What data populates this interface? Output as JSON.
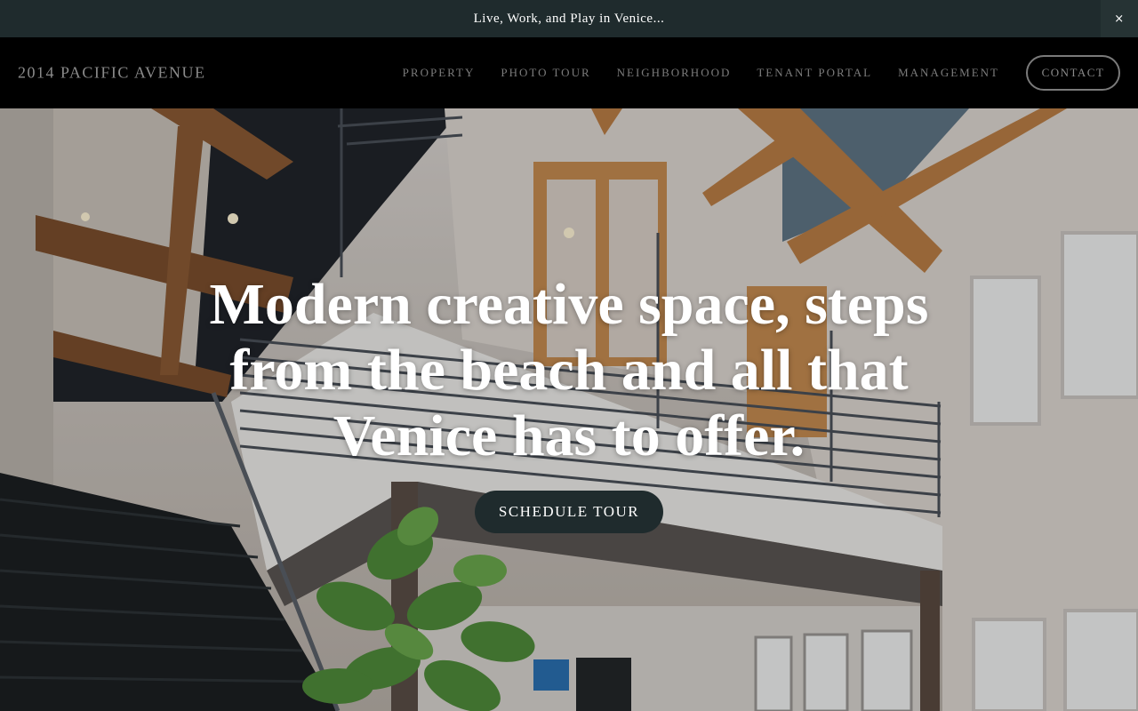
{
  "announcement": {
    "text": "Live, Work, and Play in Venice...",
    "close_glyph": "×"
  },
  "header": {
    "logo": "2014 PACIFIC AVENUE",
    "nav": [
      {
        "label": "PROPERTY"
      },
      {
        "label": "PHOTO TOUR"
      },
      {
        "label": "NEIGHBORHOOD"
      },
      {
        "label": "TENANT PORTAL"
      },
      {
        "label": "MANAGEMENT"
      }
    ],
    "contact_label": "CONTACT"
  },
  "hero": {
    "headline": "Modern creative space, steps from the beach and all that Venice has to offer.",
    "cta_label": "SCHEDULE TOUR",
    "image_subject": "loft-interior-photo"
  },
  "colors": {
    "announcement_bg": "#1f2b2d",
    "header_bg": "#000000",
    "cta_bg": "#1f2b2d",
    "nav_text": "#7b7b7b"
  }
}
